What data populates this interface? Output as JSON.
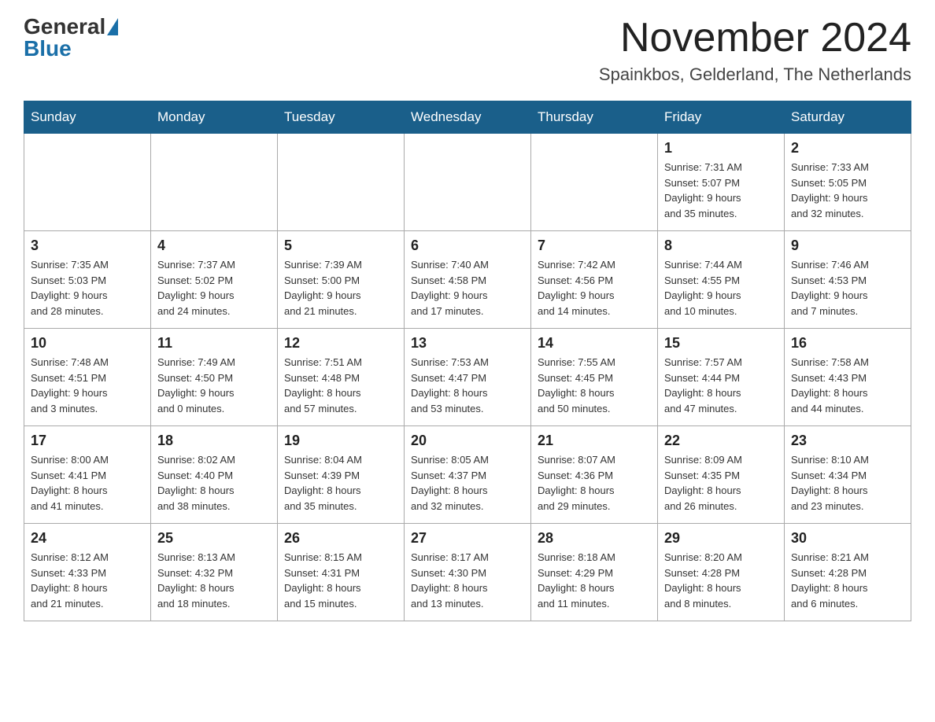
{
  "header": {
    "logo_general": "General",
    "logo_blue": "Blue",
    "month_title": "November 2024",
    "location": "Spainkbos, Gelderland, The Netherlands"
  },
  "weekdays": [
    "Sunday",
    "Monday",
    "Tuesday",
    "Wednesday",
    "Thursday",
    "Friday",
    "Saturday"
  ],
  "weeks": [
    [
      {
        "day": "",
        "info": ""
      },
      {
        "day": "",
        "info": ""
      },
      {
        "day": "",
        "info": ""
      },
      {
        "day": "",
        "info": ""
      },
      {
        "day": "",
        "info": ""
      },
      {
        "day": "1",
        "info": "Sunrise: 7:31 AM\nSunset: 5:07 PM\nDaylight: 9 hours\nand 35 minutes."
      },
      {
        "day": "2",
        "info": "Sunrise: 7:33 AM\nSunset: 5:05 PM\nDaylight: 9 hours\nand 32 minutes."
      }
    ],
    [
      {
        "day": "3",
        "info": "Sunrise: 7:35 AM\nSunset: 5:03 PM\nDaylight: 9 hours\nand 28 minutes."
      },
      {
        "day": "4",
        "info": "Sunrise: 7:37 AM\nSunset: 5:02 PM\nDaylight: 9 hours\nand 24 minutes."
      },
      {
        "day": "5",
        "info": "Sunrise: 7:39 AM\nSunset: 5:00 PM\nDaylight: 9 hours\nand 21 minutes."
      },
      {
        "day": "6",
        "info": "Sunrise: 7:40 AM\nSunset: 4:58 PM\nDaylight: 9 hours\nand 17 minutes."
      },
      {
        "day": "7",
        "info": "Sunrise: 7:42 AM\nSunset: 4:56 PM\nDaylight: 9 hours\nand 14 minutes."
      },
      {
        "day": "8",
        "info": "Sunrise: 7:44 AM\nSunset: 4:55 PM\nDaylight: 9 hours\nand 10 minutes."
      },
      {
        "day": "9",
        "info": "Sunrise: 7:46 AM\nSunset: 4:53 PM\nDaylight: 9 hours\nand 7 minutes."
      }
    ],
    [
      {
        "day": "10",
        "info": "Sunrise: 7:48 AM\nSunset: 4:51 PM\nDaylight: 9 hours\nand 3 minutes."
      },
      {
        "day": "11",
        "info": "Sunrise: 7:49 AM\nSunset: 4:50 PM\nDaylight: 9 hours\nand 0 minutes."
      },
      {
        "day": "12",
        "info": "Sunrise: 7:51 AM\nSunset: 4:48 PM\nDaylight: 8 hours\nand 57 minutes."
      },
      {
        "day": "13",
        "info": "Sunrise: 7:53 AM\nSunset: 4:47 PM\nDaylight: 8 hours\nand 53 minutes."
      },
      {
        "day": "14",
        "info": "Sunrise: 7:55 AM\nSunset: 4:45 PM\nDaylight: 8 hours\nand 50 minutes."
      },
      {
        "day": "15",
        "info": "Sunrise: 7:57 AM\nSunset: 4:44 PM\nDaylight: 8 hours\nand 47 minutes."
      },
      {
        "day": "16",
        "info": "Sunrise: 7:58 AM\nSunset: 4:43 PM\nDaylight: 8 hours\nand 44 minutes."
      }
    ],
    [
      {
        "day": "17",
        "info": "Sunrise: 8:00 AM\nSunset: 4:41 PM\nDaylight: 8 hours\nand 41 minutes."
      },
      {
        "day": "18",
        "info": "Sunrise: 8:02 AM\nSunset: 4:40 PM\nDaylight: 8 hours\nand 38 minutes."
      },
      {
        "day": "19",
        "info": "Sunrise: 8:04 AM\nSunset: 4:39 PM\nDaylight: 8 hours\nand 35 minutes."
      },
      {
        "day": "20",
        "info": "Sunrise: 8:05 AM\nSunset: 4:37 PM\nDaylight: 8 hours\nand 32 minutes."
      },
      {
        "day": "21",
        "info": "Sunrise: 8:07 AM\nSunset: 4:36 PM\nDaylight: 8 hours\nand 29 minutes."
      },
      {
        "day": "22",
        "info": "Sunrise: 8:09 AM\nSunset: 4:35 PM\nDaylight: 8 hours\nand 26 minutes."
      },
      {
        "day": "23",
        "info": "Sunrise: 8:10 AM\nSunset: 4:34 PM\nDaylight: 8 hours\nand 23 minutes."
      }
    ],
    [
      {
        "day": "24",
        "info": "Sunrise: 8:12 AM\nSunset: 4:33 PM\nDaylight: 8 hours\nand 21 minutes."
      },
      {
        "day": "25",
        "info": "Sunrise: 8:13 AM\nSunset: 4:32 PM\nDaylight: 8 hours\nand 18 minutes."
      },
      {
        "day": "26",
        "info": "Sunrise: 8:15 AM\nSunset: 4:31 PM\nDaylight: 8 hours\nand 15 minutes."
      },
      {
        "day": "27",
        "info": "Sunrise: 8:17 AM\nSunset: 4:30 PM\nDaylight: 8 hours\nand 13 minutes."
      },
      {
        "day": "28",
        "info": "Sunrise: 8:18 AM\nSunset: 4:29 PM\nDaylight: 8 hours\nand 11 minutes."
      },
      {
        "day": "29",
        "info": "Sunrise: 8:20 AM\nSunset: 4:28 PM\nDaylight: 8 hours\nand 8 minutes."
      },
      {
        "day": "30",
        "info": "Sunrise: 8:21 AM\nSunset: 4:28 PM\nDaylight: 8 hours\nand 6 minutes."
      }
    ]
  ]
}
